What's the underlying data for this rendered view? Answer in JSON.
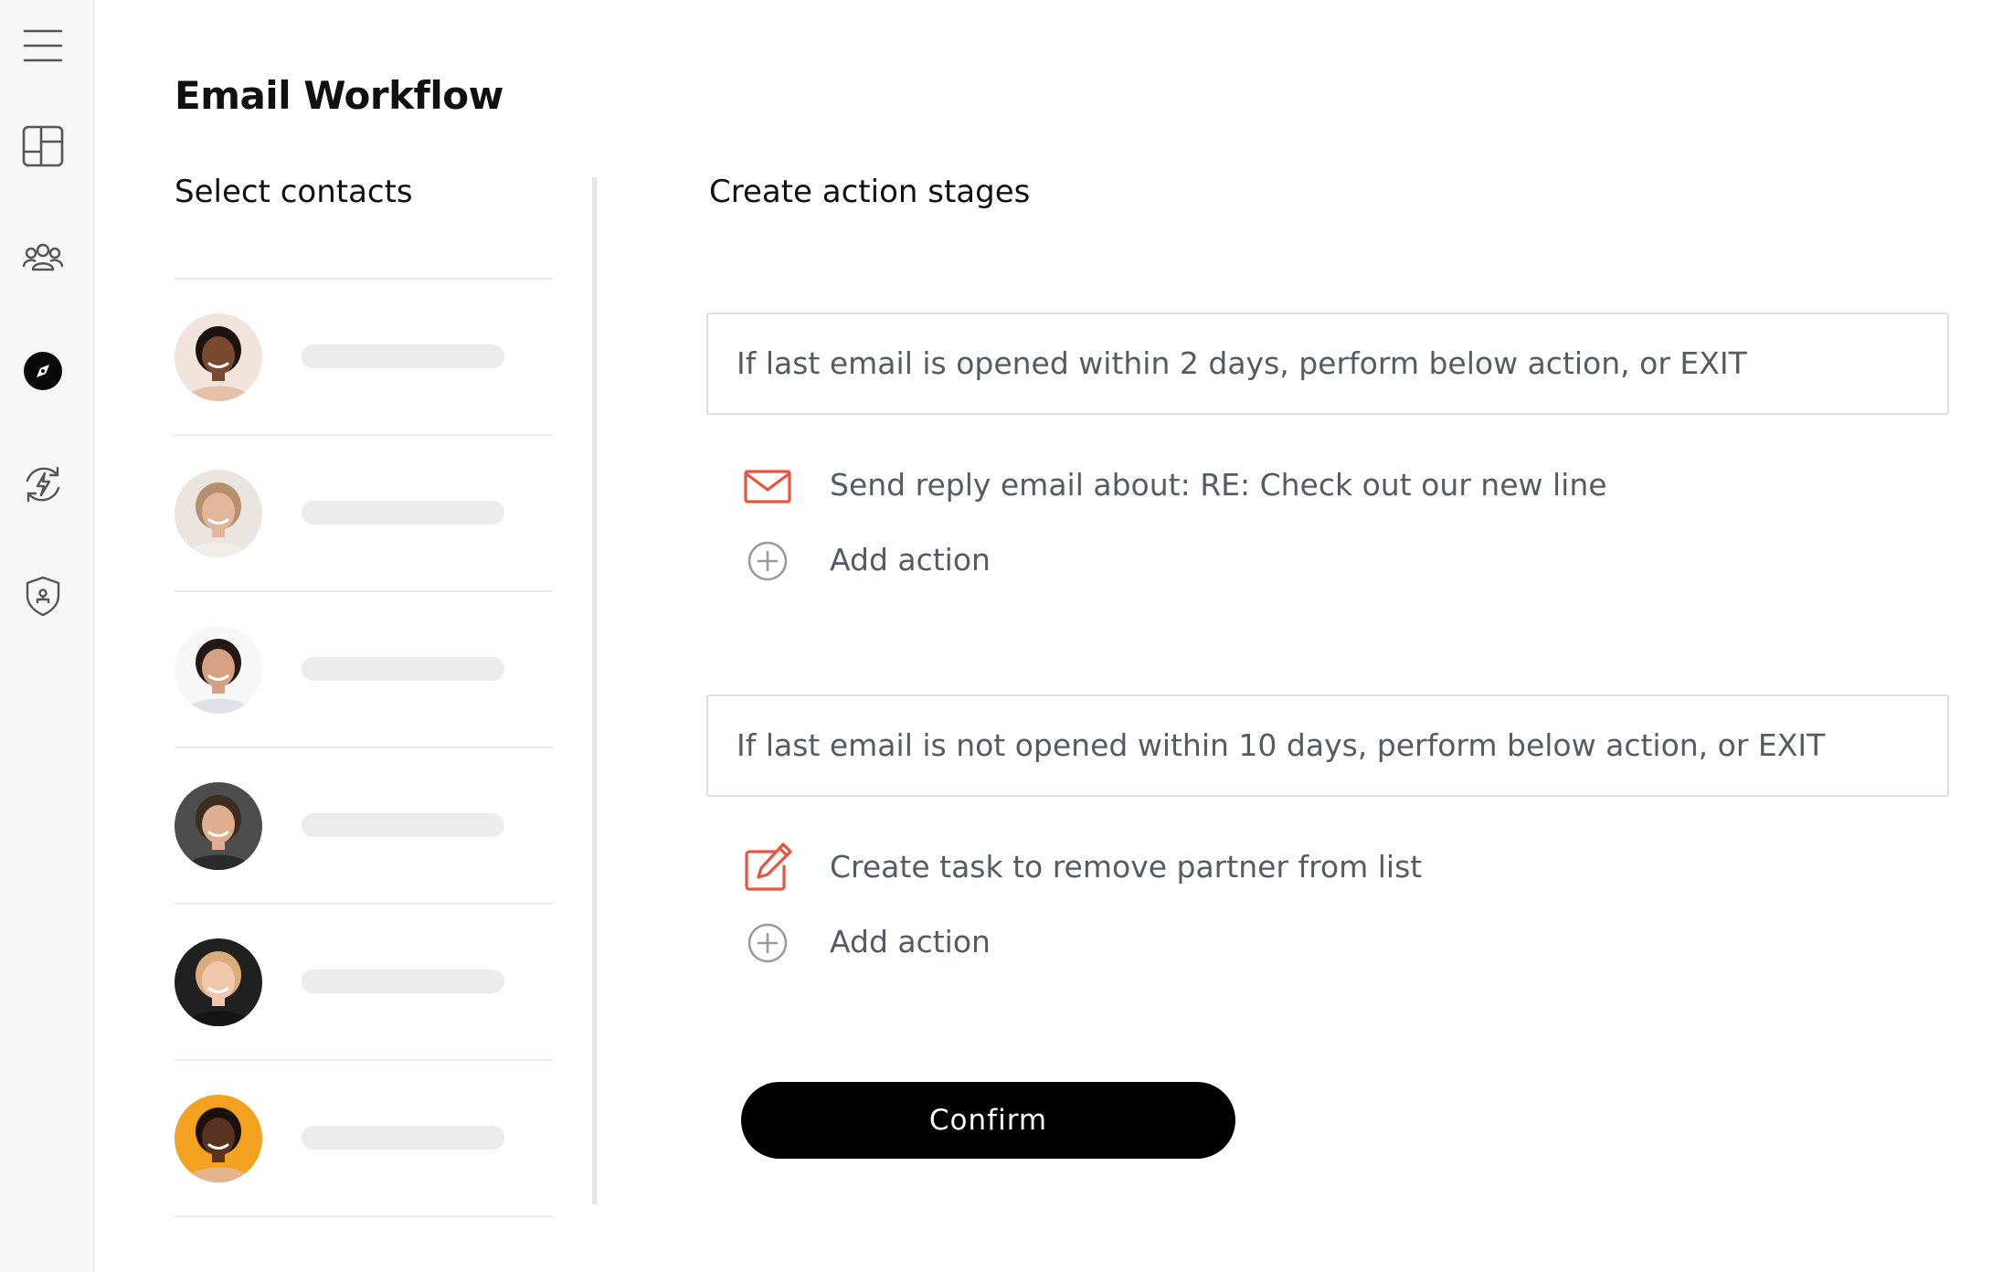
{
  "app": {
    "title": "Email Workflow"
  },
  "sidebar": {
    "items": [
      {
        "name": "menu",
        "icon": "hamburger-menu-icon"
      },
      {
        "name": "dashboard",
        "icon": "layout-grid-icon"
      },
      {
        "name": "contacts",
        "icon": "users-group-icon"
      },
      {
        "name": "explore",
        "icon": "compass-icon",
        "active": true
      },
      {
        "name": "automation",
        "icon": "lightning-refresh-icon"
      },
      {
        "name": "security",
        "icon": "shield-lock-icon"
      }
    ]
  },
  "contacts": {
    "heading": "Select contacts",
    "items": [
      {
        "avatar": "avatar-1",
        "skin": "#7a4a30",
        "hair": "#1c130e",
        "bg": "#f1e4dc",
        "shirt": "#e5c1a9"
      },
      {
        "avatar": "avatar-2",
        "skin": "#e2b69c",
        "hair": "#b58f6e",
        "bg": "#eae5e1",
        "shirt": "#f0ede9"
      },
      {
        "avatar": "avatar-3",
        "skin": "#d6a183",
        "hair": "#231a15",
        "bg": "#f7f7f7",
        "shirt": "#dfe3e7"
      },
      {
        "avatar": "avatar-4",
        "skin": "#deae8f",
        "hair": "#3e2c1f",
        "bg": "#4d4d4d",
        "shirt": "#2b2b2b"
      },
      {
        "avatar": "avatar-5",
        "skin": "#f0c7ad",
        "hair": "#d9ad7b",
        "bg": "#202020",
        "shirt": "#151515"
      },
      {
        "avatar": "avatar-6",
        "skin": "#5a3320",
        "hair": "#1a110c",
        "bg": "#f2a21e",
        "shirt": "#e5b48c"
      }
    ]
  },
  "stages": {
    "heading": "Create action stages",
    "list": [
      {
        "condition": "If last email is opened within 2 days, perform below action, or EXIT",
        "action": {
          "icon": "mail-icon",
          "label": "Send reply email about: RE: Check out our new line"
        },
        "add_label": "Add action"
      },
      {
        "condition": "If last email is not opened within 10 days, perform below action, or EXIT",
        "action": {
          "icon": "edit-task-icon",
          "label": "Create task to remove partner from list"
        },
        "add_label": "Add action"
      }
    ]
  },
  "footer": {
    "confirm_label": "Confirm"
  },
  "colors": {
    "accent": "#e8553f",
    "text_muted": "#565a63",
    "button_bg": "#000000",
    "divider": "#e6e6e6"
  }
}
